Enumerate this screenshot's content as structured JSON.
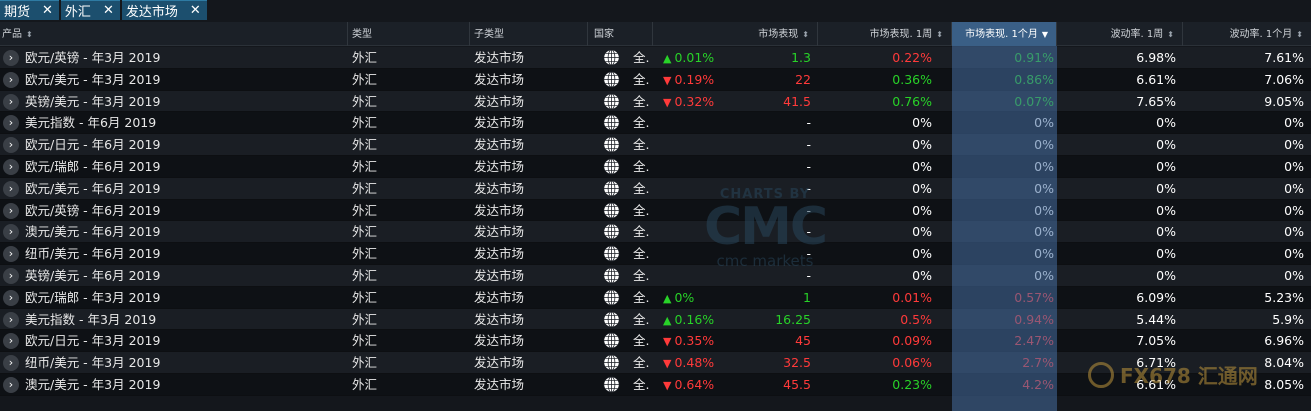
{
  "tabs": [
    {
      "label": "期货"
    },
    {
      "label": "外汇"
    },
    {
      "label": "发达市场"
    }
  ],
  "close_glyph": "✕",
  "columns": {
    "product": "产品",
    "type": "类型",
    "subtype": "子类型",
    "country": "国家",
    "perf": "市场表现",
    "perf_1w": "市场表现. 1周",
    "perf_1m": "市场表现. 1个月",
    "vol_1w": "波动率. 1周",
    "vol_1m": "波动率. 1个月"
  },
  "rows": [
    {
      "product": "欧元/英镑 - 年3月 2019",
      "type": "外汇",
      "subtype": "发达市场",
      "country": "全.",
      "perf_dir": "up",
      "perf_pct": "0.01%",
      "perf_val": "1.3",
      "perf_1w": "0.22%",
      "perf_1w_dir": "down",
      "perf_1m": "0.91%",
      "perf_1m_dir": "up",
      "vol_1w": "6.98%",
      "vol_1m": "7.61%"
    },
    {
      "product": "欧元/美元 - 年3月 2019",
      "type": "外汇",
      "subtype": "发达市场",
      "country": "全.",
      "perf_dir": "down",
      "perf_pct": "0.19%",
      "perf_val": "22",
      "perf_1w": "0.36%",
      "perf_1w_dir": "up",
      "perf_1m": "0.86%",
      "perf_1m_dir": "up",
      "vol_1w": "6.61%",
      "vol_1m": "7.06%"
    },
    {
      "product": "英镑/美元 - 年3月 2019",
      "type": "外汇",
      "subtype": "发达市场",
      "country": "全.",
      "perf_dir": "down",
      "perf_pct": "0.32%",
      "perf_val": "41.5",
      "perf_1w": "0.76%",
      "perf_1w_dir": "up",
      "perf_1m": "0.07%",
      "perf_1m_dir": "up",
      "vol_1w": "7.65%",
      "vol_1m": "9.05%"
    },
    {
      "product": "美元指数 - 年6月 2019",
      "type": "外汇",
      "subtype": "发达市场",
      "country": "全.",
      "perf_dir": "none",
      "perf_pct": "",
      "perf_val": "-",
      "perf_1w": "0%",
      "perf_1w_dir": "neutral",
      "perf_1m": "0%",
      "perf_1m_dir": "neutral",
      "vol_1w": "0%",
      "vol_1m": "0%"
    },
    {
      "product": "欧元/日元 - 年6月 2019",
      "type": "外汇",
      "subtype": "发达市场",
      "country": "全.",
      "perf_dir": "none",
      "perf_pct": "",
      "perf_val": "-",
      "perf_1w": "0%",
      "perf_1w_dir": "neutral",
      "perf_1m": "0%",
      "perf_1m_dir": "neutral",
      "vol_1w": "0%",
      "vol_1m": "0%"
    },
    {
      "product": "欧元/瑞郎 - 年6月 2019",
      "type": "外汇",
      "subtype": "发达市场",
      "country": "全.",
      "perf_dir": "none",
      "perf_pct": "",
      "perf_val": "-",
      "perf_1w": "0%",
      "perf_1w_dir": "neutral",
      "perf_1m": "0%",
      "perf_1m_dir": "neutral",
      "vol_1w": "0%",
      "vol_1m": "0%"
    },
    {
      "product": "欧元/美元 - 年6月 2019",
      "type": "外汇",
      "subtype": "发达市场",
      "country": "全.",
      "perf_dir": "none",
      "perf_pct": "",
      "perf_val": "-",
      "perf_1w": "0%",
      "perf_1w_dir": "neutral",
      "perf_1m": "0%",
      "perf_1m_dir": "neutral",
      "vol_1w": "0%",
      "vol_1m": "0%"
    },
    {
      "product": "欧元/英镑 - 年6月 2019",
      "type": "外汇",
      "subtype": "发达市场",
      "country": "全.",
      "perf_dir": "none",
      "perf_pct": "",
      "perf_val": "-",
      "perf_1w": "0%",
      "perf_1w_dir": "neutral",
      "perf_1m": "0%",
      "perf_1m_dir": "neutral",
      "vol_1w": "0%",
      "vol_1m": "0%"
    },
    {
      "product": "澳元/美元 - 年6月 2019",
      "type": "外汇",
      "subtype": "发达市场",
      "country": "全.",
      "perf_dir": "none",
      "perf_pct": "",
      "perf_val": "-",
      "perf_1w": "0%",
      "perf_1w_dir": "neutral",
      "perf_1m": "0%",
      "perf_1m_dir": "neutral",
      "vol_1w": "0%",
      "vol_1m": "0%"
    },
    {
      "product": "纽币/美元 - 年6月 2019",
      "type": "外汇",
      "subtype": "发达市场",
      "country": "全.",
      "perf_dir": "none",
      "perf_pct": "",
      "perf_val": "-",
      "perf_1w": "0%",
      "perf_1w_dir": "neutral",
      "perf_1m": "0%",
      "perf_1m_dir": "neutral",
      "vol_1w": "0%",
      "vol_1m": "0%"
    },
    {
      "product": "英镑/美元 - 年6月 2019",
      "type": "外汇",
      "subtype": "发达市场",
      "country": "全.",
      "perf_dir": "none",
      "perf_pct": "",
      "perf_val": "-",
      "perf_1w": "0%",
      "perf_1w_dir": "neutral",
      "perf_1m": "0%",
      "perf_1m_dir": "neutral",
      "vol_1w": "0%",
      "vol_1m": "0%"
    },
    {
      "product": "欧元/瑞郎 - 年3月 2019",
      "type": "外汇",
      "subtype": "发达市场",
      "country": "全.",
      "perf_dir": "up",
      "perf_pct": "0%",
      "perf_val": "1",
      "perf_1w": "0.01%",
      "perf_1w_dir": "down",
      "perf_1m": "0.57%",
      "perf_1m_dir": "down",
      "vol_1w": "6.09%",
      "vol_1m": "5.23%"
    },
    {
      "product": "美元指数 - 年3月 2019",
      "type": "外汇",
      "subtype": "发达市场",
      "country": "全.",
      "perf_dir": "up",
      "perf_pct": "0.16%",
      "perf_val": "16.25",
      "perf_1w": "0.5%",
      "perf_1w_dir": "down",
      "perf_1m": "0.94%",
      "perf_1m_dir": "down",
      "vol_1w": "5.44%",
      "vol_1m": "5.9%"
    },
    {
      "product": "欧元/日元 - 年3月 2019",
      "type": "外汇",
      "subtype": "发达市场",
      "country": "全.",
      "perf_dir": "down",
      "perf_pct": "0.35%",
      "perf_val": "45",
      "perf_1w": "0.09%",
      "perf_1w_dir": "down",
      "perf_1m": "2.47%",
      "perf_1m_dir": "down",
      "vol_1w": "7.05%",
      "vol_1m": "6.96%"
    },
    {
      "product": "纽币/美元 - 年3月 2019",
      "type": "外汇",
      "subtype": "发达市场",
      "country": "全.",
      "perf_dir": "down",
      "perf_pct": "0.48%",
      "perf_val": "32.5",
      "perf_1w": "0.06%",
      "perf_1w_dir": "down",
      "perf_1m": "2.7%",
      "perf_1m_dir": "down",
      "vol_1w": "6.71%",
      "vol_1m": "8.04%"
    },
    {
      "product": "澳元/美元 - 年3月 2019",
      "type": "外汇",
      "subtype": "发达市场",
      "country": "全.",
      "perf_dir": "down",
      "perf_pct": "0.64%",
      "perf_val": "45.5",
      "perf_1w": "0.23%",
      "perf_1w_dir": "up",
      "perf_1m": "4.2%",
      "perf_1m_dir": "down",
      "vol_1w": "6.61%",
      "vol_1m": "8.05%"
    }
  ],
  "watermark": {
    "top": "CHARTS BY",
    "big": "CMC",
    "sub": "cmc markets"
  },
  "fx_logo": {
    "text": "FX678 汇通网"
  },
  "colors": {
    "up": "#28d228",
    "down": "#ff3a3a",
    "tab": "#1c4f6e",
    "highlight": "#3a5f86"
  },
  "icons": {
    "expand": "chevron-right-icon",
    "country": "globe-icon",
    "up": "triangle-up-icon",
    "down": "triangle-down-icon"
  }
}
